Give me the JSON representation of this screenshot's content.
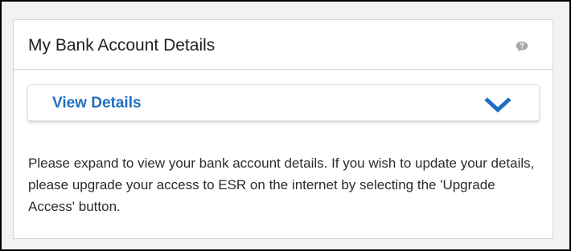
{
  "panel": {
    "title": "My Bank Account Details",
    "help_icon": "help-speech-bubble-icon",
    "details_toggle": {
      "label": "View Details",
      "icon": "chevron-down-icon",
      "expanded": false
    },
    "description": "Please expand to view your bank account details. If you wish to update your details, please upgrade your access to ESR on the internet by selecting the 'Upgrade Access' button."
  },
  "colors": {
    "accent": "#1f6fbf",
    "icon_gray": "#a6a6a6",
    "frame_border": "#000000"
  }
}
